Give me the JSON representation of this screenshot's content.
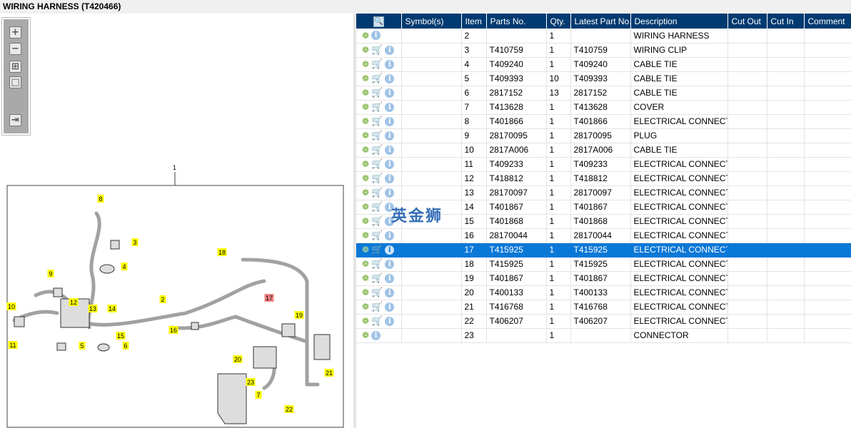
{
  "window": {
    "title": "WIRING HARNESS (T420466)"
  },
  "toolbar": {
    "buttons": [
      {
        "name": "zoom-in-icon",
        "glyph": "+"
      },
      {
        "name": "zoom-out-icon",
        "glyph": "−"
      },
      {
        "name": "fit-all-icon",
        "glyph": "⊞"
      },
      {
        "name": "actual-size-icon",
        "glyph": "□"
      },
      {
        "name": "export-list-icon",
        "glyph": "⇥"
      }
    ]
  },
  "diagram": {
    "top_label": "1",
    "callouts": [
      "8",
      "3",
      "4",
      "9",
      "18",
      "17",
      "2",
      "12",
      "10",
      "13",
      "14",
      "19",
      "16",
      "15",
      "5",
      "6",
      "11",
      "20",
      "21",
      "23",
      "7",
      "22"
    ],
    "highlighted": "17",
    "highlight_color": "#f08080",
    "callout_color": "#ffff00"
  },
  "watermark": "英金狮",
  "table": {
    "columns": [
      "",
      "Symbol(s)",
      "Item",
      "Parts No.",
      "Qty.",
      "Latest Part No.",
      "Description",
      "Cut Out",
      "Cut In",
      "Comment"
    ],
    "selected_item": "17",
    "rows": [
      {
        "cart": false,
        "item": "2",
        "part": "",
        "qty": "1",
        "latest": "",
        "desc": "WIRING HARNESS"
      },
      {
        "cart": true,
        "item": "3",
        "part": "T410759",
        "qty": "1",
        "latest": "T410759",
        "desc": "WIRING CLIP"
      },
      {
        "cart": true,
        "item": "4",
        "part": "T409240",
        "qty": "1",
        "latest": "T409240",
        "desc": "CABLE TIE"
      },
      {
        "cart": true,
        "item": "5",
        "part": "T409393",
        "qty": "10",
        "latest": "T409393",
        "desc": "CABLE TIE"
      },
      {
        "cart": true,
        "item": "6",
        "part": "2817152",
        "qty": "13",
        "latest": "2817152",
        "desc": "CABLE TIE"
      },
      {
        "cart": true,
        "item": "7",
        "part": "T413628",
        "qty": "1",
        "latest": "T413628",
        "desc": "COVER"
      },
      {
        "cart": true,
        "item": "8",
        "part": "T401866",
        "qty": "1",
        "latest": "T401866",
        "desc": "ELECTRICAL CONNECTOR"
      },
      {
        "cart": true,
        "item": "9",
        "part": "28170095",
        "qty": "1",
        "latest": "28170095",
        "desc": "PLUG"
      },
      {
        "cart": true,
        "item": "10",
        "part": "2817A006",
        "qty": "1",
        "latest": "2817A006",
        "desc": "CABLE TIE"
      },
      {
        "cart": true,
        "item": "11",
        "part": "T409233",
        "qty": "1",
        "latest": "T409233",
        "desc": "ELECTRICAL CONNECTOR"
      },
      {
        "cart": true,
        "item": "12",
        "part": "T418812",
        "qty": "1",
        "latest": "T418812",
        "desc": "ELECTRICAL CONNECTOR"
      },
      {
        "cart": true,
        "item": "13",
        "part": "28170097",
        "qty": "1",
        "latest": "28170097",
        "desc": "ELECTRICAL CONNECTOR"
      },
      {
        "cart": true,
        "item": "14",
        "part": "T401867",
        "qty": "1",
        "latest": "T401867",
        "desc": "ELECTRICAL CONNECTOR"
      },
      {
        "cart": true,
        "item": "15",
        "part": "T401868",
        "qty": "1",
        "latest": "T401868",
        "desc": "ELECTRICAL CONNECTOR"
      },
      {
        "cart": true,
        "item": "16",
        "part": "28170044",
        "qty": "1",
        "latest": "28170044",
        "desc": "ELECTRICAL CONNECTOR"
      },
      {
        "cart": true,
        "item": "17",
        "part": "T415925",
        "qty": "1",
        "latest": "T415925",
        "desc": "ELECTRICAL CONNECTOR"
      },
      {
        "cart": true,
        "item": "18",
        "part": "T415925",
        "qty": "1",
        "latest": "T415925",
        "desc": "ELECTRICAL CONNECTOR"
      },
      {
        "cart": true,
        "item": "19",
        "part": "T401867",
        "qty": "1",
        "latest": "T401867",
        "desc": "ELECTRICAL CONNECTOR"
      },
      {
        "cart": true,
        "item": "20",
        "part": "T400133",
        "qty": "1",
        "latest": "T400133",
        "desc": "ELECTRICAL CONNECTOR"
      },
      {
        "cart": true,
        "item": "21",
        "part": "T416768",
        "qty": "1",
        "latest": "T416768",
        "desc": "ELECTRICAL CONNECTOR"
      },
      {
        "cart": true,
        "item": "22",
        "part": "T406207",
        "qty": "1",
        "latest": "T406207",
        "desc": "ELECTRICAL CONNECTOR"
      },
      {
        "cart": false,
        "item": "23",
        "part": "",
        "qty": "1",
        "latest": "",
        "desc": "CONNECTOR"
      }
    ]
  }
}
